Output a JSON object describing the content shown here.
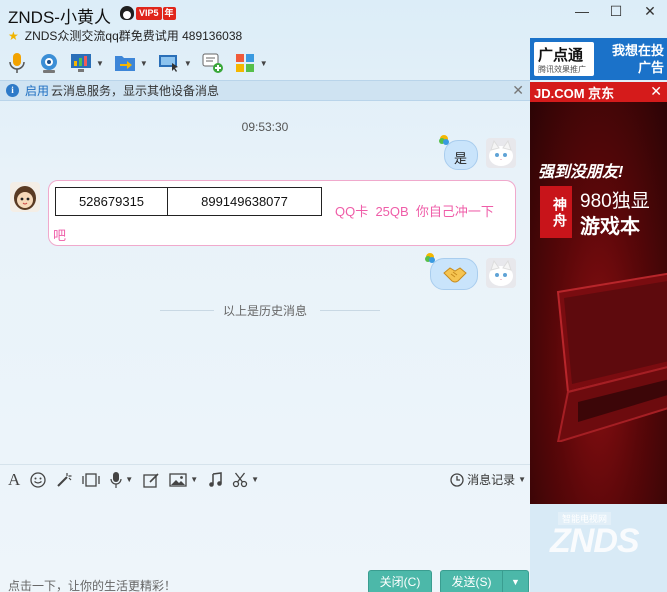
{
  "title": {
    "name": "ZNDS-小黄人",
    "vip_text": "VIP5",
    "vip_year": "年",
    "subtitle": "ZNDS众测交流qq群免费试用 489136038"
  },
  "window_controls": {
    "minimize": "—",
    "maximize": "☐",
    "close": "✕"
  },
  "infobar": {
    "link": "启用",
    "text": "云消息服务，显示其他设备消息"
  },
  "chat": {
    "timestamp": "09:53:30",
    "msg1": "是",
    "table": [
      [
        "528679315",
        "899149638077"
      ]
    ],
    "msg2_inline": "QQ卡  25QB  你自己冲一下",
    "msg2_tail": "吧",
    "history_label": "以上是历史消息"
  },
  "input": {
    "history_button": "消息记录",
    "hint": "点击一下，让你的生活更精彩！",
    "close_button": "关闭(C)",
    "send_button": "发送(S)"
  },
  "ad": {
    "logo_main": "广点通",
    "logo_sub": "腾讯效果推广",
    "want_ad": "我想在投广告",
    "jd": "JD.COM 京东",
    "slogan": "强到没朋友!",
    "brand": "神舟",
    "gpu": "980独显",
    "gamebook": "游戏本",
    "watermark": "ZNDS",
    "watermark_site": "智能电视网"
  },
  "colors": {
    "accent_button": "#4cb8a9",
    "pink_text": "#ef5da8",
    "link": "#1f6fc1"
  }
}
